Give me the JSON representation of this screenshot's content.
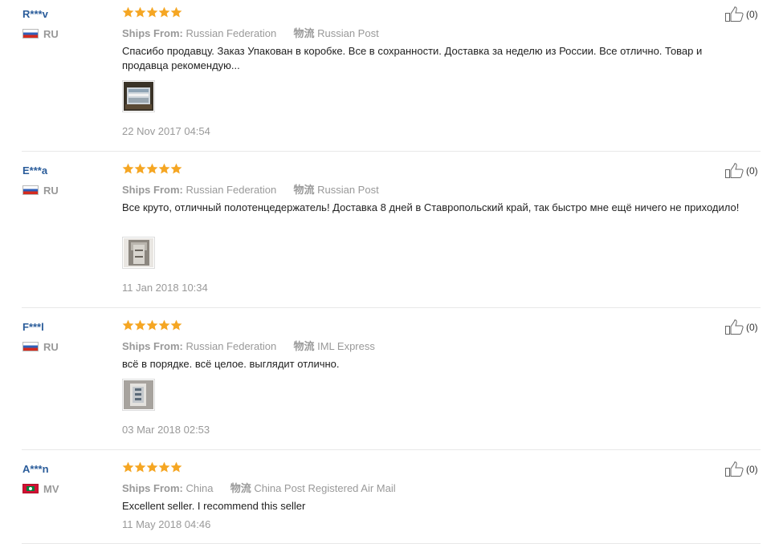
{
  "labels": {
    "ships_from": "Ships From:",
    "carrier": "物流"
  },
  "colors": {
    "star": "#f5a623",
    "username": "#2a5c9a",
    "muted": "#999999"
  },
  "reviews": [
    {
      "user": "R***v",
      "country": "RU",
      "flag": "ru-flag",
      "rating": 5,
      "ships_from": "Russian Federation",
      "carrier": "Russian Post",
      "text": "Спасибо продавцу. Заказ Упакован в коробке. Все в сохранности. Доставка за неделю из России. Все отлично. Товар и продавца рекомендую...",
      "has_photo": true,
      "date": "22 Nov 2017 04:54",
      "likes": "(0)"
    },
    {
      "user": "E***a",
      "country": "RU",
      "flag": "ru-flag",
      "rating": 5,
      "ships_from": "Russian Federation",
      "carrier": "Russian Post",
      "text": "Все круто, отличный полотенцедержатель! Доставка 8 дней в Ставропольский край, так быстро мне ещё ничего не приходило!",
      "has_photo": true,
      "date": "11 Jan 2018 10:34",
      "likes": "(0)"
    },
    {
      "user": "F***l",
      "country": "RU",
      "flag": "ru-flag",
      "rating": 5,
      "ships_from": "Russian Federation",
      "carrier": "IML Express",
      "text": "всё в порядке. всё целое. выглядит отлично.",
      "has_photo": true,
      "date": "03 Mar 2018 02:53",
      "likes": "(0)"
    },
    {
      "user": "A***n",
      "country": "MV",
      "flag": "mv-flag",
      "rating": 5,
      "ships_from": "China",
      "carrier": "China Post Registered Air Mail",
      "text": "Excellent seller. I recommend this seller",
      "has_photo": false,
      "date": "11 May 2018 04:46",
      "likes": "(0)"
    }
  ]
}
